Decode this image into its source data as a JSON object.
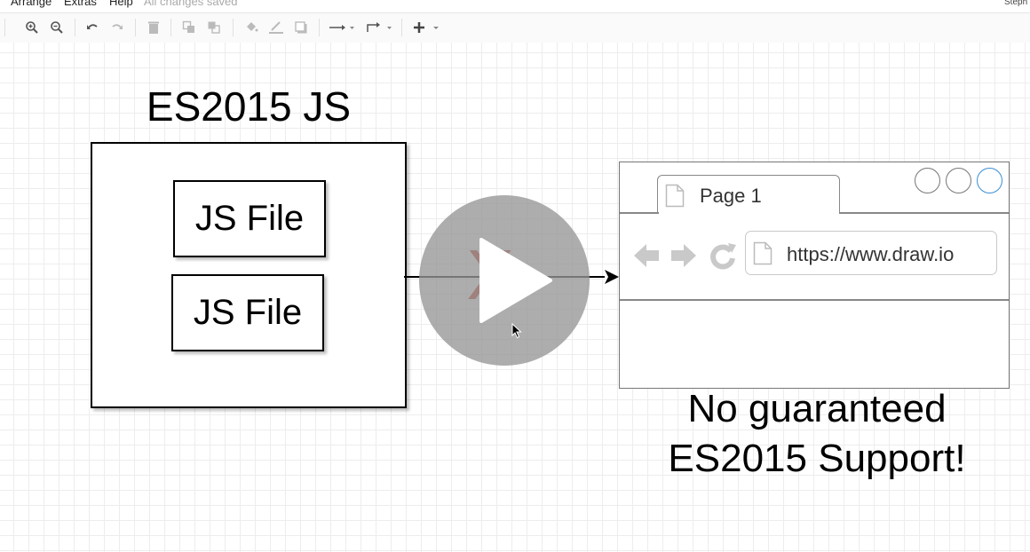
{
  "menubar": {
    "items": [
      "Arrange",
      "Extras",
      "Help"
    ],
    "status": "All changes saved",
    "user": "Steph"
  },
  "toolbar": {
    "icons": [
      "zoom-in-icon",
      "zoom-out-icon",
      "undo-icon",
      "redo-icon",
      "delete-icon",
      "to-front-icon",
      "to-back-icon",
      "fill-color-icon",
      "line-color-icon",
      "shadow-icon",
      "connection-icon",
      "waypoints-icon",
      "insert-icon"
    ]
  },
  "diagram": {
    "title": "ES2015 JS",
    "files": [
      "JS File",
      "JS File"
    ],
    "blocked_mark": "X",
    "browser": {
      "tab_label": "Page 1",
      "url": "https://www.draw.io"
    },
    "caption_line1": "No guaranteed",
    "caption_line2": "ES2015 Support!"
  },
  "colors": {
    "blocked_mark": "#c0392b",
    "window_button_highlight": "#3b8fd6",
    "browser_controls": "#c9c9c9"
  }
}
